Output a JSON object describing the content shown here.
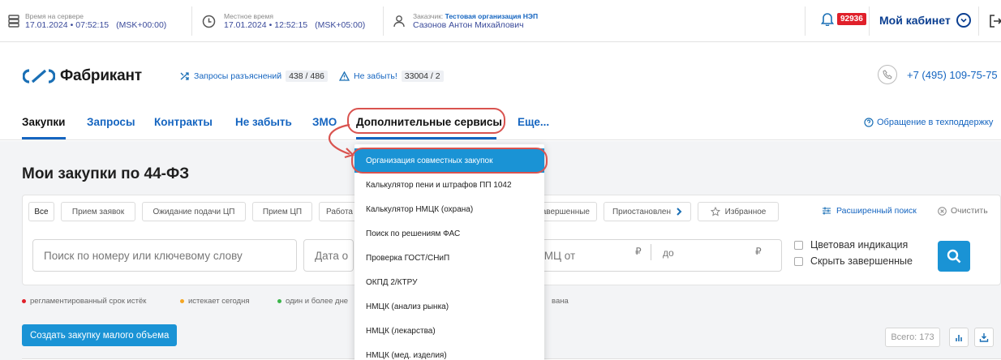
{
  "topbar": {
    "server_time": {
      "label": "Время на сервере",
      "date": "17.01.2024",
      "time": "07:52:15",
      "tz": "(MSK+00:00)"
    },
    "local_time": {
      "label": "Местное время",
      "date": "17.01.2024",
      "time": "12:52:15",
      "tz": "(MSK+05:00)"
    },
    "customer": {
      "label": "Заказчик:",
      "org": "Тестовая организация НЭП",
      "person": "Сазонов Антон Михайлович"
    },
    "notifications_count": "92936",
    "cabinet_label": "Мой кабинет"
  },
  "brand": {
    "name": "Фабрикант",
    "clarifications_label": "Запросы разъяснений",
    "clarifications_count": "438 / 486",
    "remind_label": "Не забыть!",
    "remind_count": "33004 / 2",
    "phone": "+7 (495) 109-75-75"
  },
  "nav": {
    "items": [
      "Закупки",
      "Запросы",
      "Контракты",
      "Не забыть",
      "ЗМО",
      "Дополнительные сервисы",
      "Еще..."
    ],
    "support": "Обращение в техподдержку"
  },
  "main": {
    "title": "Мои закупки по 44-ФЗ",
    "tabs": [
      "Все",
      "Прием заявок",
      "Ожидание подачи ЦП",
      "Прием ЦП",
      "Работа",
      "Завершенные",
      "Приостановлен",
      "Избранное"
    ],
    "advanced_search": "Расширенный поиск",
    "clear": "Очистить",
    "search_placeholder": "Поиск по номеру или ключевому слову",
    "date_placeholder": "Дата о",
    "nmc_from": "НМЦ от",
    "nmc_to": "до",
    "currency": "₽",
    "color_indication": "Цветовая индикация",
    "hide_completed": "Скрыть завершенные",
    "legend": [
      {
        "text": "регламентированный срок истёк",
        "color": "#e0202a"
      },
      {
        "text": "истекает сегодня",
        "color": "#f5a623"
      },
      {
        "text": "один и более дне",
        "color": "#3bb54a"
      },
      {
        "text": "вана",
        "color": ""
      }
    ],
    "create_button": "Создать закупку малого объема",
    "total": "Всего: 173"
  },
  "dropdown": {
    "items": [
      "Организация совместных закупок",
      "Калькулятор пени и штрафов ПП 1042",
      "Калькулятор НМЦК (охрана)",
      "Поиск по решениям ФАС",
      "Проверка ГОСТ/СНиП",
      "ОКПД 2/КТРУ",
      "НМЦК (анализ рынка)",
      "НМЦК (лекарства)",
      "НМЦК (мед. изделия)"
    ]
  },
  "colors": {
    "accent": "#1565c0",
    "button": "#1a93d5",
    "highlight": "#d9534f",
    "badge": "#e0202a"
  }
}
